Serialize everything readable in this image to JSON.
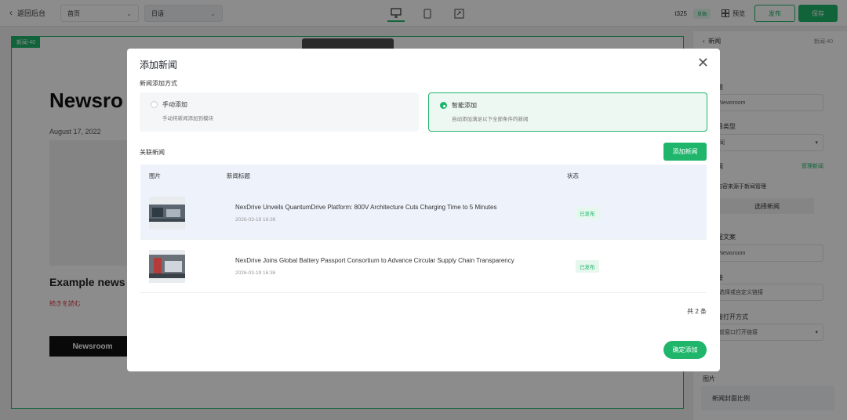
{
  "topbar": {
    "back_label": "返回后台",
    "page_select": "首页",
    "lang_select": "日语",
    "site_id": "t325",
    "draft_badge": "草稿",
    "preview_label": "预览",
    "publish_label": "发布",
    "save_label": "保存"
  },
  "canvas": {
    "label": "新闻-40",
    "title": "Newsro",
    "date": "August 17, 2022",
    "example": "Example news",
    "more": "続きを読む",
    "button": "Newsroom"
  },
  "right_panel": {
    "header": "新闻",
    "id": "新闻-40",
    "fields": [
      {
        "label": "题",
        "value": "Newsroom"
      },
      {
        "label": "目类型",
        "value": "闻"
      },
      {
        "label": "闻",
        "link": "管理新闻",
        "note": "内容来源于新闻管理",
        "button": "选择新闻"
      },
      {
        "label": "钮文案",
        "value": "Newsroom"
      },
      {
        "label": "接",
        "value": "选择或自定义链接"
      },
      {
        "label": "接打开方式",
        "value": "前窗口打开链接"
      }
    ],
    "image_section": "图片",
    "cover_ratio": "新闻封面比例"
  },
  "modal": {
    "title": "添加新闻",
    "method_label": "新闻添加方式",
    "options": [
      {
        "title": "手动添加",
        "desc": "手动将新闻添加到模块",
        "selected": false
      },
      {
        "title": "智能添加",
        "desc": "自动添加满足以下全部条件的新闻",
        "selected": true
      }
    ],
    "related_label": "关联新闻",
    "add_button": "添加新闻",
    "columns": [
      "图片",
      "新闻标题",
      "状态"
    ],
    "rows": [
      {
        "title": "NexDrive Unveils QuantumDrive Platform: 800V Architecture Cuts Charging Time to 5 Minutes",
        "date": "2026-03-19 16:36",
        "status": "已发布"
      },
      {
        "title": "NexDrive Joins Global Battery Passport Consortium to Advance Circular Supply Chain Transparency",
        "date": "2026-03-19 16:36",
        "status": "已发布"
      }
    ],
    "total": "共 2 条",
    "confirm_button": "确定添加"
  },
  "colors": {
    "accent": "#1fb56b"
  }
}
